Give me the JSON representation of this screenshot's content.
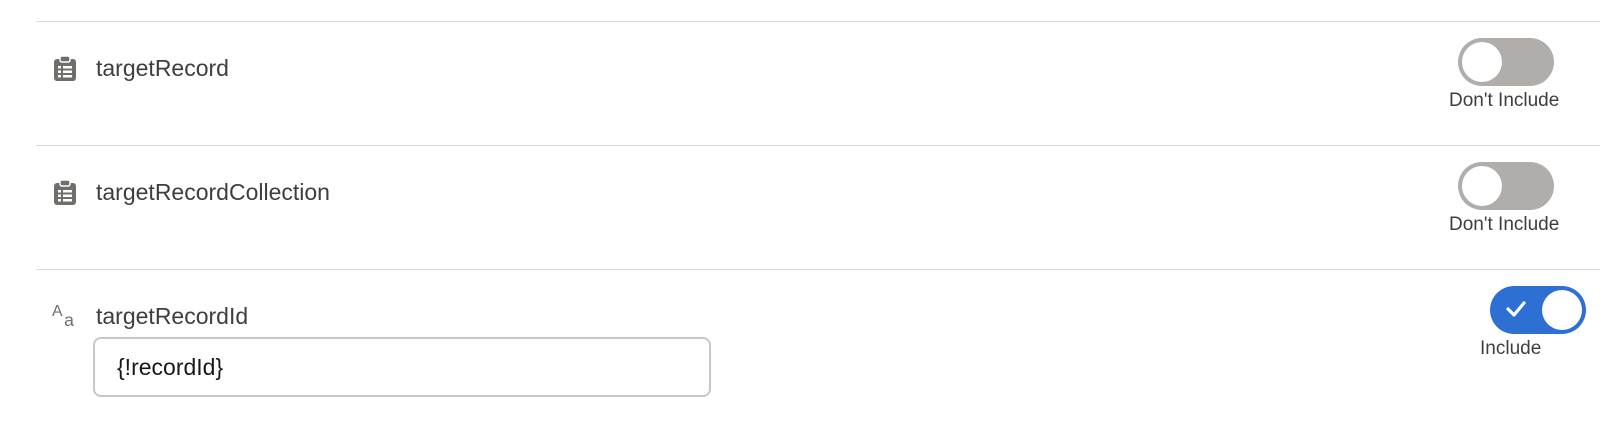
{
  "rows": [
    {
      "label": "targetRecord",
      "icon": "clipboard-icon",
      "toggle_state": "off",
      "toggle_caption": "Don't Include"
    },
    {
      "label": "targetRecordCollection",
      "icon": "clipboard-icon",
      "toggle_state": "off",
      "toggle_caption": "Don't Include"
    },
    {
      "label": "targetRecordId",
      "icon": "text-type-icon",
      "icon_text_upper": "A",
      "icon_text_lower": "a",
      "toggle_state": "on",
      "toggle_caption": "Include",
      "input_value": "{!recordId}"
    }
  ],
  "colors": {
    "toggle_on": "#2d6fd2",
    "toggle_off": "#b0adab",
    "divider": "#dddbda",
    "text": "#3e3e3c"
  }
}
